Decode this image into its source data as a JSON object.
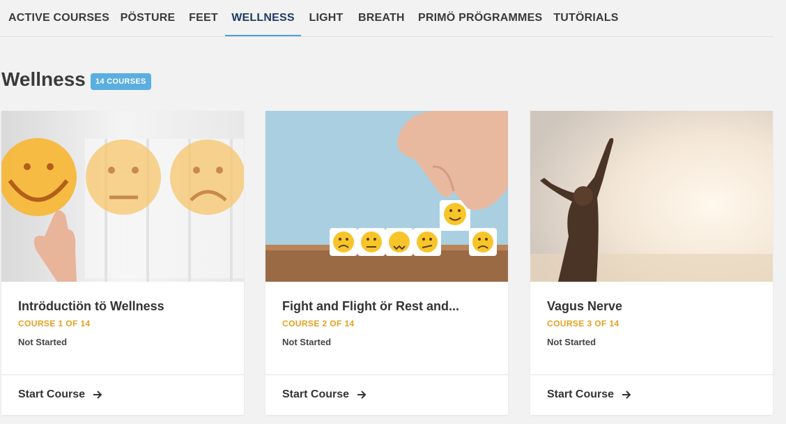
{
  "tabs": [
    {
      "label": "ACTIVE COURSES"
    },
    {
      "label": "PÖSTURE"
    },
    {
      "label": "FEET"
    },
    {
      "label": "WELLNESS"
    },
    {
      "label": "LIGHT"
    },
    {
      "label": "BREATH"
    },
    {
      "label": "PRIMÖ PRÖGRAMMES"
    },
    {
      "label": "TUTÖRIALS"
    }
  ],
  "active_tab": "WELLNESS",
  "section": {
    "title": "Wellness",
    "badge": "14 COURSES"
  },
  "cards": [
    {
      "title": "Intröductiön tö Wellness",
      "course_label": "COURSE 1 OF 14",
      "status": "Not Started",
      "cta": "Start Course"
    },
    {
      "title": "Fight and Flight ör Rest and...",
      "course_label": "COURSE 2 OF 14",
      "status": "Not Started",
      "cta": "Start Course"
    },
    {
      "title": "Vagus Nerve",
      "course_label": "COURSE 3 OF 14",
      "status": "Not Started",
      "cta": "Start Course"
    }
  ],
  "colors": {
    "accent": "#4aa3d8",
    "badge": "#5aaee0",
    "course_label": "#e6a01e",
    "active_tab_text": "#1f3b63"
  }
}
